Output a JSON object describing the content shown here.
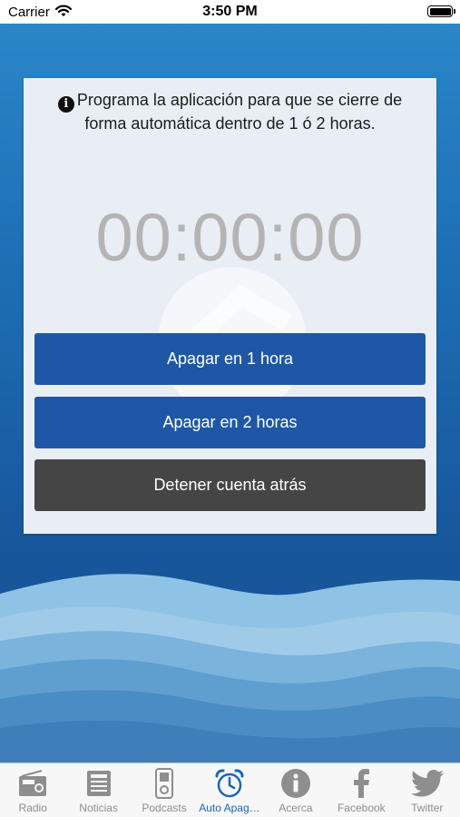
{
  "status_bar": {
    "carrier": "Carrier",
    "time": "3:50 PM"
  },
  "card": {
    "info_text": "Programa la aplicación para que se cierre de forma automática dentro de 1 ó 2 horas.",
    "timer": "00:00:00",
    "buttons": {
      "one_hour": "Apagar en 1 hora",
      "two_hours": "Apagar en 2 horas",
      "stop": "Detener cuenta atrás"
    }
  },
  "tabs": [
    {
      "label": "Radio",
      "icon": "radio-icon"
    },
    {
      "label": "Noticias",
      "icon": "newspaper-icon"
    },
    {
      "label": "Podcasts",
      "icon": "podcast-player-icon"
    },
    {
      "label": "Auto Apagado",
      "icon": "alarm-clock-icon",
      "active": true
    },
    {
      "label": "Acerca",
      "icon": "info-icon"
    },
    {
      "label": "Facebook",
      "icon": "facebook-icon"
    },
    {
      "label": "Twitter",
      "icon": "twitter-icon"
    }
  ],
  "colors": {
    "accent": "#1e57a6",
    "stop_button": "#454545",
    "active_tab": "#1a66b8",
    "inactive_tab": "#8e8e8e"
  }
}
